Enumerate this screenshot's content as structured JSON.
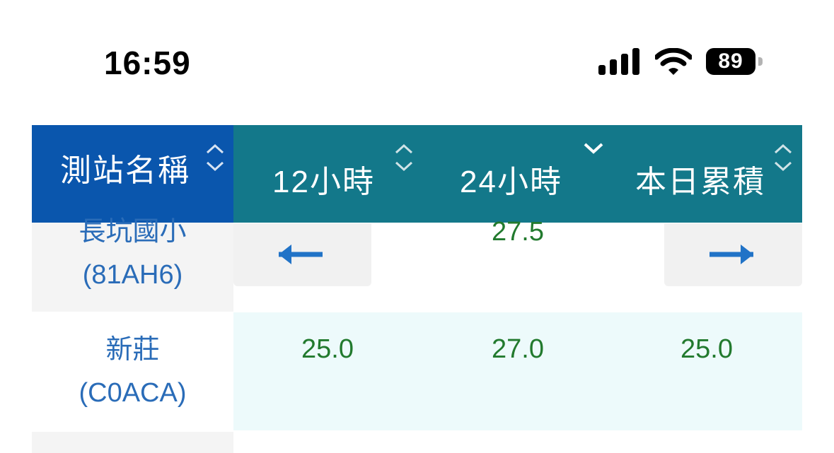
{
  "status_bar": {
    "time": "16:59",
    "battery": "89",
    "icons": [
      "cellular-signal-icon",
      "wifi-icon",
      "battery-icon"
    ]
  },
  "table": {
    "headers": {
      "station": "測站名稱",
      "h12": "12小時",
      "h24": "24小時",
      "today": "本日累積"
    },
    "sort": {
      "station": "unsorted",
      "h12": "unsorted",
      "h24": "descending",
      "today": "unsorted"
    },
    "rows": [
      {
        "name": "長坑國小",
        "code": "(81AH6)",
        "h24": "27.5"
      },
      {
        "name": "新莊",
        "code": "(C0ACA)",
        "h12": "25.0",
        "h24": "27.0",
        "today": "25.0"
      }
    ],
    "nav": {
      "left_icon": "arrow-left-icon",
      "right_icon": "arrow-right-icon"
    },
    "colors": {
      "station_header": "#0a56ad",
      "data_header": "#13788a",
      "station_text": "#2a6cb8",
      "value_text": "#227a2e",
      "highlight_row": "#edfafb",
      "station_cell_alt": "#f4f4f4"
    }
  }
}
